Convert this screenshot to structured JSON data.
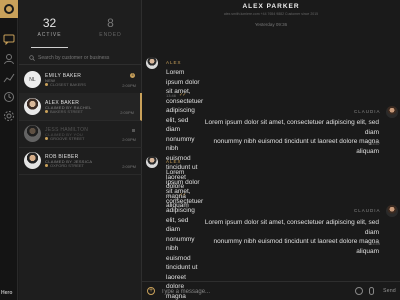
{
  "app": {
    "brand": "Hero"
  },
  "list": {
    "tabs": [
      {
        "count": "32",
        "label": "ACTIVE"
      },
      {
        "count": "8",
        "label": "ENDED"
      }
    ],
    "search_placeholder": "Search by customer or business",
    "conversations": [
      {
        "initials": "NL",
        "name": "EMILY BAKER",
        "status": "NEW",
        "store": "CLOSEST BAKERS",
        "time": "2:00PM",
        "badge": "3"
      },
      {
        "name": "ALEX BAKER",
        "status": "CLAIMED BY RACHEL",
        "store": "BAKERS STREET",
        "time": "2:00PM"
      },
      {
        "name": "JESS HAMILTON",
        "status": "CLAIMED BY YOU",
        "store": "GROOVE STREET",
        "time": "2:00PM"
      },
      {
        "name": "ROB BIEBER",
        "status": "CLAIMED BY JESSICA",
        "store": "OXFORD STREET",
        "time": "2:00PM"
      }
    ]
  },
  "chat": {
    "title": "ALEX PARKER",
    "info": "alex.smith.lumiere.com   +44 7654 9882   Customer since 2015",
    "date": "Yesterday 09:36",
    "messages": [
      {
        "side": "left",
        "sender": "ALEX",
        "line1": "Lorem ipsum dolor sit amet, consectetuer adipiscing elit, sed diam",
        "line2": "nonummy nibh euismod tincidunt ut laoreet dolore magna aliquam",
        "time": "13:46",
        "ticks": "✓✓"
      },
      {
        "side": "right",
        "sender": "CLAUDIA",
        "line1": "Lorem ipsum dolor sit amet, consectetuer adipiscing elit, sed diam",
        "line2": "nonummy nibh euismod tincidunt ut laoreet dolore magna aliquam",
        "time": "13:47"
      },
      {
        "side": "left",
        "sender": "ALEX",
        "line1": "Lorem ipsum dolor sit amet, consectetuer adipiscing elit, sed diam",
        "line2": "nonummy nibh euismod tincidunt ut laoreet dolore magna aliquam",
        "time": "13:48",
        "ticks": "✓✓"
      },
      {
        "side": "right",
        "sender": "CLAUDIA",
        "line1": "Lorem ipsum dolor sit amet, consectetuer adipiscing elit, sed diam",
        "line2": "nonummy nibh euismod tincidunt ut laoreet dolore magna aliquam",
        "time": "13:49"
      }
    ],
    "composer": {
      "placeholder": "Type a message...",
      "send_label": "Send"
    }
  },
  "colors": {
    "accent": "#c9a15a",
    "background": "#1a1a1a"
  },
  "icons": [
    "logo-icon",
    "chat-icon",
    "user-icon",
    "chart-icon",
    "clock-icon",
    "settings-icon",
    "search-icon",
    "emoji-icon",
    "attach-icon",
    "add-icon"
  ]
}
